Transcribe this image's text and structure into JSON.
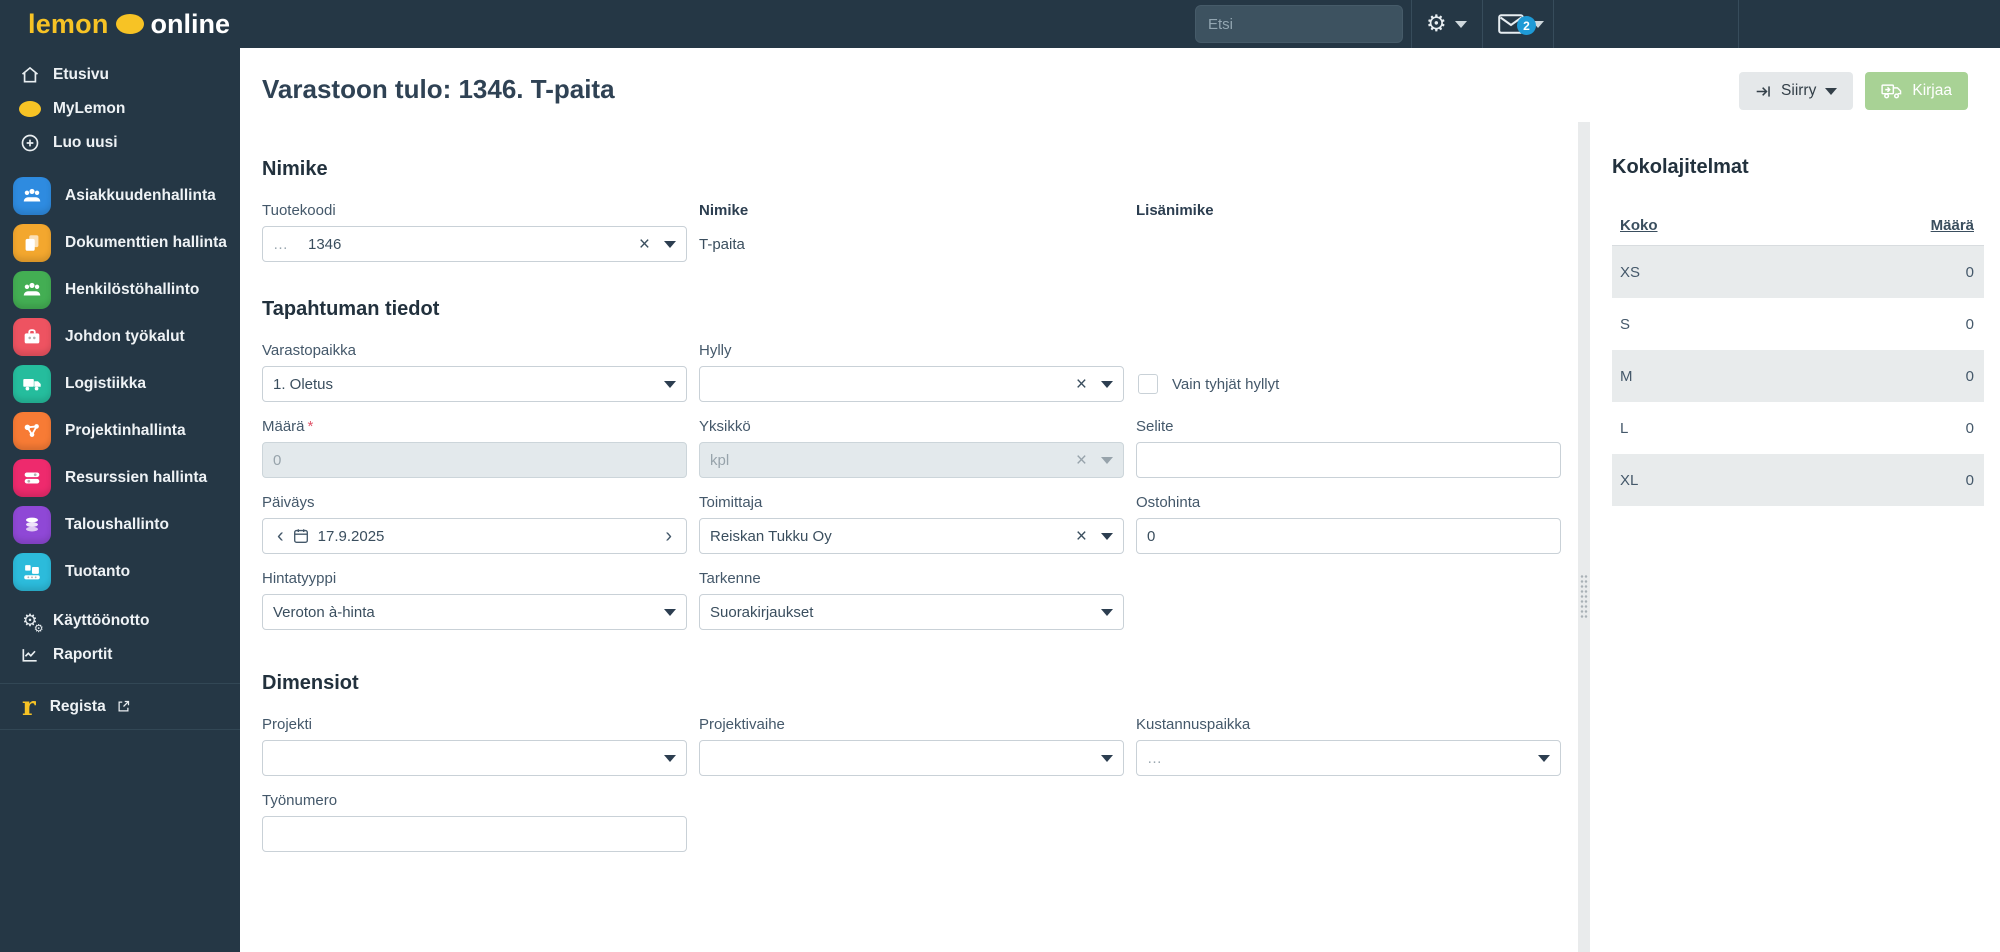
{
  "colors": {
    "navy": "#253745",
    "accent_yellow": "#f7c325",
    "badge_blue": "#1e9ad6",
    "kirjaa_green": "#a8d295",
    "stripe_gray": "#e8ebec"
  },
  "topbar": {
    "logo_part1": "lemon",
    "logo_part2": "online",
    "search_placeholder": "Etsi",
    "mail_badge": "2"
  },
  "sidebar": {
    "top_items": [
      {
        "label": "Etusivu"
      },
      {
        "label": "MyLemon"
      },
      {
        "label": "Luo uusi"
      }
    ],
    "modules": [
      {
        "label": "Asiakkuudenhallinta",
        "color": "#2e8be0",
        "icon": "users-icon"
      },
      {
        "label": "Dokumenttien hallinta",
        "color": "#f3a72e",
        "icon": "documents-icon"
      },
      {
        "label": "Henkilöstöhallinto",
        "color": "#43ae53",
        "icon": "users-icon"
      },
      {
        "label": "Johdon työkalut",
        "color": "#ee5361",
        "icon": "briefcase-icon"
      },
      {
        "label": "Logistiikka",
        "color": "#25bd9d",
        "icon": "truck-icon"
      },
      {
        "label": "Projektinhallinta",
        "color": "#f77b35",
        "icon": "network-icon"
      },
      {
        "label": "Resurssien hallinta",
        "color": "#ee2a6d",
        "icon": "sliders-icon"
      },
      {
        "label": "Taloushallinto",
        "color": "#8f48d6",
        "icon": "coins-icon"
      },
      {
        "label": "Tuotanto",
        "color": "#2cbbdb",
        "icon": "production-icon"
      }
    ],
    "tools": [
      {
        "label": "Käyttöönotto"
      },
      {
        "label": "Raportit"
      }
    ],
    "footer": {
      "label": "Regista"
    }
  },
  "header": {
    "title": "Varastoon tulo: 1346. T-paita",
    "siirry_label": "Siirry",
    "kirjaa_label": "Kirjaa"
  },
  "form": {
    "nimike_section": {
      "heading": "Nimike",
      "tuotekoodi": {
        "label": "Tuotekoodi",
        "prefix": "…",
        "value": "1346"
      },
      "nimike": {
        "label": "Nimike",
        "value": "T-paita"
      },
      "lisanimike": {
        "label": "Lisänimike",
        "value": ""
      }
    },
    "tapahtuma_section": {
      "heading": "Tapahtuman tiedot",
      "varastopaikka": {
        "label": "Varastopaikka",
        "value": "1. Oletus"
      },
      "hylly": {
        "label": "Hylly",
        "value": ""
      },
      "vain_tyhjat": {
        "label": "Vain tyhjät hyllyt",
        "checked": false
      },
      "maara": {
        "label": "Määrä",
        "required_mark": "*",
        "value": "0"
      },
      "yksikko": {
        "label": "Yksikkö",
        "value": "kpl"
      },
      "selite": {
        "label": "Selite",
        "value": ""
      },
      "paivays": {
        "label": "Päiväys",
        "value": "17.9.2025",
        "prev": "‹",
        "next": "›"
      },
      "toimittaja": {
        "label": "Toimittaja",
        "value": "Reiskan Tukku Oy"
      },
      "ostohinta": {
        "label": "Ostohinta",
        "value": "0"
      },
      "hintatyyppi": {
        "label": "Hintatyyppi",
        "value": "Veroton à-hinta"
      },
      "tarkenne": {
        "label": "Tarkenne",
        "value": "Suorakirjaukset"
      }
    },
    "dimensiot_section": {
      "heading": "Dimensiot",
      "projekti": {
        "label": "Projekti",
        "value": ""
      },
      "projektivaihe": {
        "label": "Projektivaihe",
        "value": ""
      },
      "kustannuspaikka": {
        "label": "Kustannuspaikka",
        "value": "…"
      },
      "tyonumero": {
        "label": "Työnumero",
        "value": ""
      }
    },
    "clear_glyph": "×"
  },
  "panel": {
    "heading": "Kokolajitelmat",
    "columns": {
      "koko": "Koko",
      "maara": "Määrä"
    },
    "rows": [
      {
        "koko": "XS",
        "maara": "0"
      },
      {
        "koko": "S",
        "maara": "0"
      },
      {
        "koko": "M",
        "maara": "0"
      },
      {
        "koko": "L",
        "maara": "0"
      },
      {
        "koko": "XL",
        "maara": "0"
      }
    ]
  }
}
